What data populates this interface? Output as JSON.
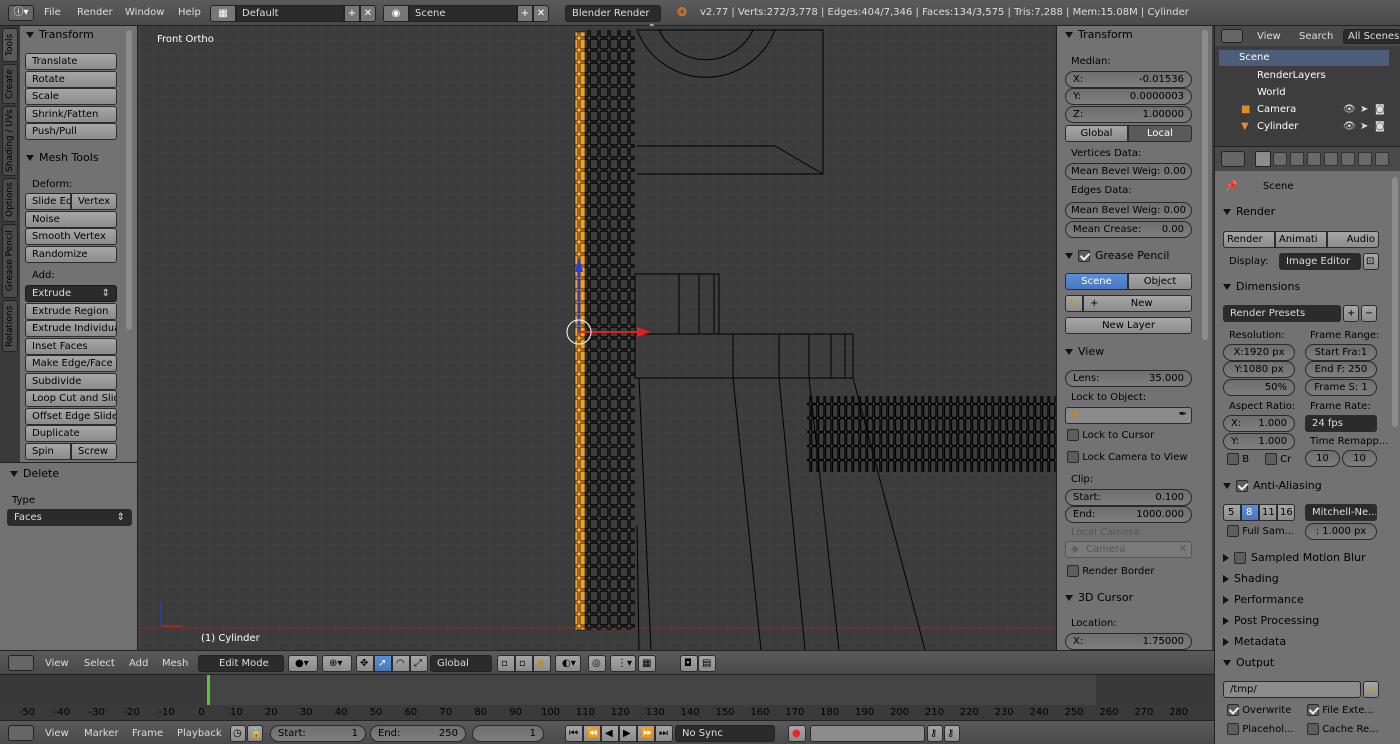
{
  "topbar": {
    "menus": [
      "File",
      "Render",
      "Window",
      "Help"
    ],
    "layout": "Default",
    "scene": "Scene",
    "engine": "Blender Render",
    "stats": "v2.77 | Verts:272/3,778 | Edges:404/7,346 | Faces:134/3,575 | Tris:7,288 | Mem:15.08M | Cylinder"
  },
  "tool_tabs": [
    "Tools",
    "Create",
    "Shading / UVs",
    "Options",
    "Grease Pencil",
    "Relations"
  ],
  "tools": {
    "transform_header": "Transform",
    "translate": "Translate",
    "rotate": "Rotate",
    "scale": "Scale",
    "shrink": "Shrink/Fatten",
    "push": "Push/Pull",
    "mesh_tools_header": "Mesh Tools",
    "deform": "Deform:",
    "slide_edge": "Slide Ed",
    "vertex": "Vertex",
    "noise": "Noise",
    "smooth": "Smooth Vertex",
    "randomize": "Randomize",
    "add": "Add:",
    "extrude": "Extrude",
    "extrude_region": "Extrude Region",
    "extrude_individual": "Extrude Individual",
    "inset": "Inset Faces",
    "make_edge": "Make Edge/Face",
    "subdivide": "Subdivide",
    "loop_cut": "Loop Cut and Slide",
    "offset_edge": "Offset Edge Slide",
    "duplicate": "Duplicate",
    "spin": "Spin",
    "screw": "Screw"
  },
  "operator": {
    "header": "Delete",
    "type_label": "Type",
    "type_value": "Faces"
  },
  "viewport": {
    "view_name": "Front Ortho",
    "object_name": "(1) Cylinder"
  },
  "properties_n": {
    "transform": "Transform",
    "median": "Median:",
    "x_label": "X:",
    "x": "-0.01536",
    "y_label": "Y:",
    "y": "0.0000003",
    "z_label": "Z:",
    "z": "1.00000",
    "global": "Global",
    "local": "Local",
    "vertices_data": "Vertices Data:",
    "mean_bevel_v": "Mean Bevel Weig: 0.00",
    "edges_data": "Edges Data:",
    "mean_bevel_e": "Mean Bevel Weig: 0.00",
    "mean_crease_label": "Mean Crease:",
    "mean_crease": "0.00",
    "grease_pencil": "Grease Pencil",
    "scene": "Scene",
    "object": "Object",
    "new": "New",
    "new_layer": "New Layer",
    "view": "View",
    "lens_label": "Lens:",
    "lens": "35.000",
    "lock_to_object": "Lock to Object:",
    "lock_cursor": "Lock to Cursor",
    "lock_camera": "Lock Camera to View",
    "clip": "Clip:",
    "start_label": "Start:",
    "start": "0.100",
    "end_label": "End:",
    "end": "1000.000",
    "local_camera": "Local Camera:",
    "camera": "Camera",
    "render_border": "Render Border",
    "cursor_3d": "3D Cursor",
    "location": "Location:",
    "loc_x_label": "X:",
    "loc_x": "1.75000"
  },
  "outliner": {
    "view": "View",
    "search": "Search",
    "all_scenes": "All Scenes",
    "items": [
      "Scene",
      "RenderLayers",
      "World",
      "Camera",
      "Cylinder"
    ]
  },
  "render_props": {
    "scene": "Scene",
    "render": "Render",
    "render_btn": "Render",
    "animation_btn": "Animati",
    "audio_btn": "Audio",
    "display_label": "Display:",
    "display_value": "Image Editor",
    "dimensions": "Dimensions",
    "render_presets": "Render Presets",
    "resolution": "Resolution:",
    "res_x": "X:1920 px",
    "res_y": "Y:1080 px",
    "res_pct": "50%",
    "frame_range": "Frame Range:",
    "start_frame": "Start Fra:1",
    "end_frame": "End F: 250",
    "frame_step": "Frame S: 1",
    "aspect_ratio": "Aspect Ratio:",
    "asp_x_label": "X:",
    "asp_x": "1.000",
    "asp_y_label": "Y:",
    "asp_y": "1.000",
    "frame_rate": "Frame Rate:",
    "fps": "24 fps",
    "time_remap": "Time Remapp...",
    "remap_old": "10",
    "remap_new": "10",
    "b_label": "B",
    "cr_label": "Cr",
    "anti_aliasing": "Anti-Aliasing",
    "aa_samples": [
      "5",
      "8",
      "11",
      "16"
    ],
    "filter": "Mitchell-Ne...",
    "full_sample": "Full Sam...",
    "filter_size": ": 1.000 px",
    "motion_blur": "Sampled Motion Blur",
    "shading": "Shading",
    "performance": "Performance",
    "post_processing": "Post Processing",
    "metadata": "Metadata",
    "output": "Output",
    "output_path": "/tmp/",
    "overwrite": "Overwrite",
    "file_ext": "File Exte...",
    "placeholders": "Placehol...",
    "cache_result": "Cache Re..."
  },
  "header3d": {
    "view": "View",
    "select": "Select",
    "add": "Add",
    "mesh": "Mesh",
    "mode": "Edit Mode",
    "orientation": "Global"
  },
  "timeline": {
    "ticks": [
      "-50",
      "-40",
      "-30",
      "-20",
      "-10",
      "0",
      "10",
      "20",
      "30",
      "40",
      "50",
      "60",
      "70",
      "80",
      "90",
      "100",
      "110",
      "120",
      "130",
      "140",
      "150",
      "160",
      "170",
      "180",
      "190",
      "200",
      "210",
      "220",
      "230",
      "240",
      "250",
      "260",
      "270",
      "280"
    ],
    "view": "View",
    "marker": "Marker",
    "frame": "Frame",
    "playback": "Playback",
    "start_label": "Start:",
    "start": "1",
    "end_label": "End:",
    "end": "250",
    "current": "1",
    "sync": "No Sync"
  },
  "colors": {
    "selected": "#f0a030",
    "axis_x": "#e02020",
    "axis_z": "#2040e0",
    "highlight": "#5680c2"
  }
}
